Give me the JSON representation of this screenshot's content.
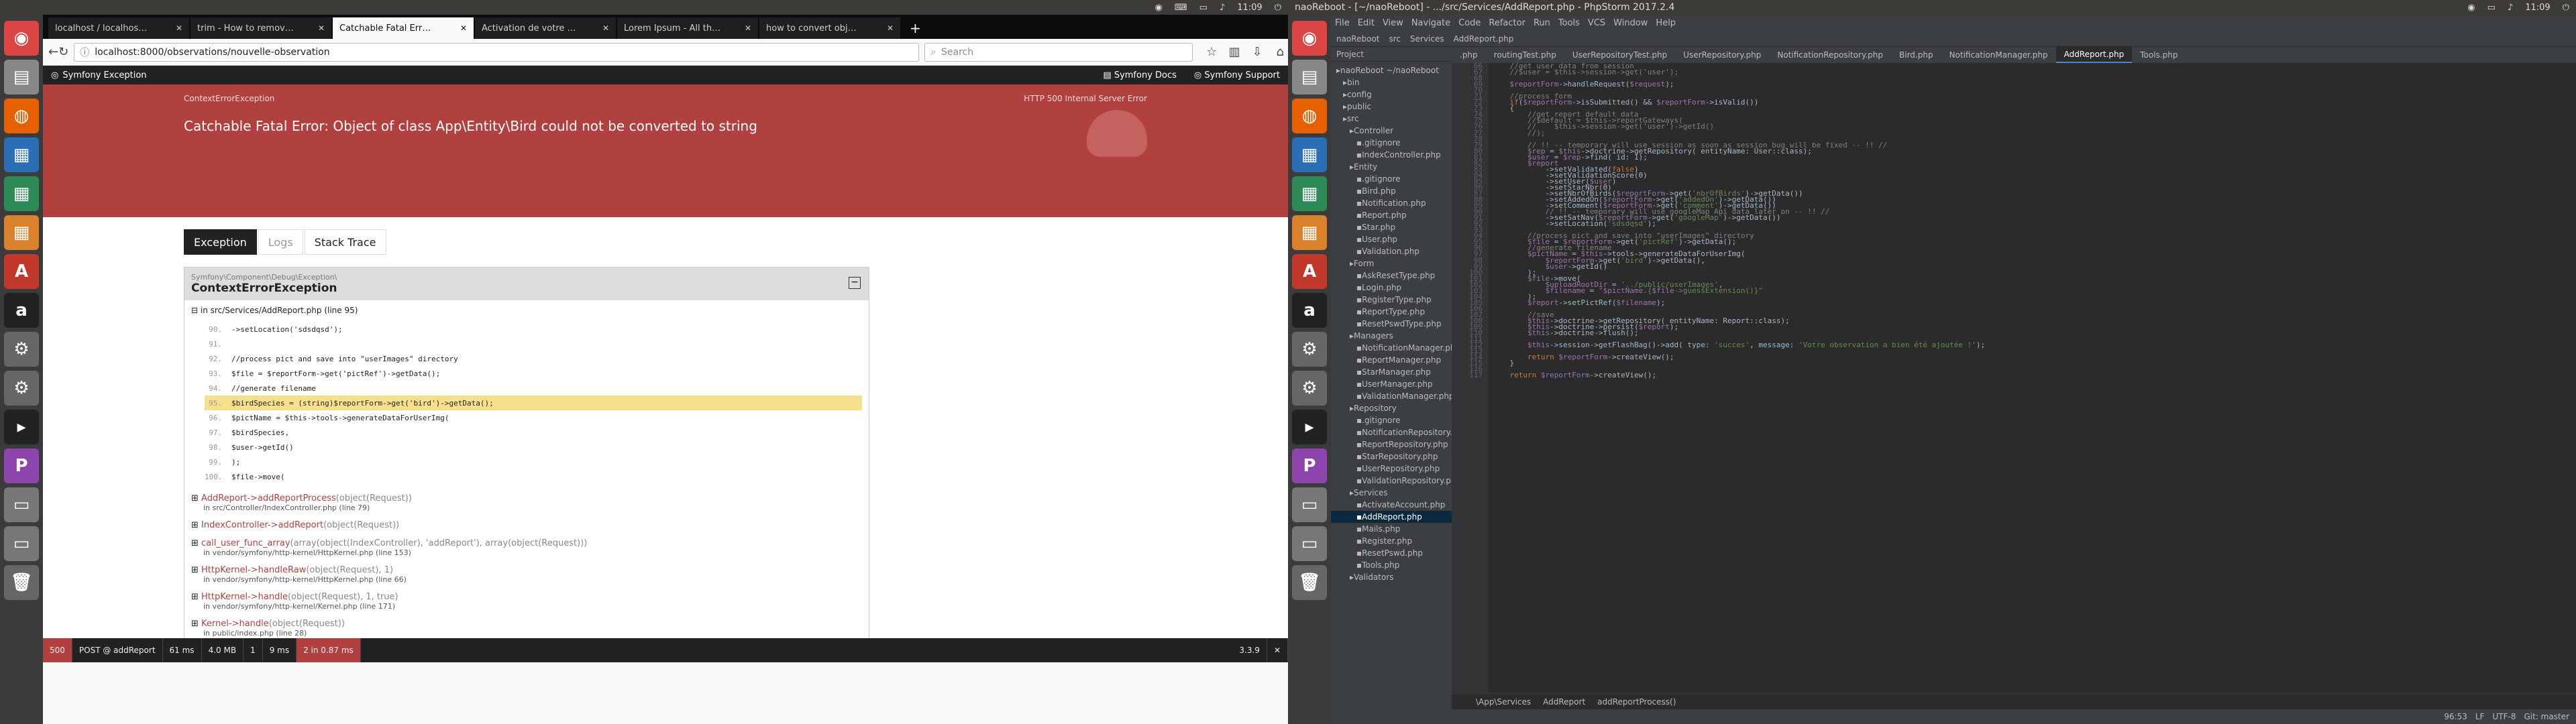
{
  "left": {
    "topbar": {
      "time": "11:09"
    },
    "launcher": [
      "chrome-icon",
      "files-icon",
      "firefox-icon",
      "writer-icon",
      "calc-icon",
      "impress-icon",
      "software-icon",
      "amazon-icon",
      "settings-icon",
      "settings2-icon",
      "terminal-icon",
      "phpstorm-icon",
      "drive-icon",
      "drive2-icon",
      "trash-icon"
    ],
    "browser": {
      "tabs": [
        {
          "label": "localhost / localhos…",
          "active": false
        },
        {
          "label": "trim - How to remov…",
          "active": false
        },
        {
          "label": "Catchable Fatal Err…",
          "active": true
        },
        {
          "label": "Activation de votre …",
          "active": false
        },
        {
          "label": "Lorem Ipsum - All th…",
          "active": false
        },
        {
          "label": "how to convert obj…",
          "active": false
        }
      ],
      "url": "localhost:8000/observations/nouvelle-observation",
      "search_placeholder": "Search",
      "symfony": {
        "brand": "Symfony Exception",
        "docs": "Symfony Docs",
        "support": "Symfony Support",
        "exception_type": "ContextErrorException",
        "http_status": "HTTP 500",
        "http_text": "Internal Server Error",
        "title": "Catchable Fatal Error: Object of class App\\Entity\\Bird could not be converted to string",
        "tabs": [
          "Exception",
          "Logs",
          "Stack Trace"
        ],
        "box_class": "Symfony\\Component\\Debug\\Exception\\",
        "box_name": "ContextErrorException",
        "location": "in src/Services/AddReport.php (line 95)",
        "code": [
          {
            "ln": "90.",
            "text": "->setLocation('sdsdqsd');",
            "hl": false
          },
          {
            "ln": "91.",
            "text": "",
            "hl": false
          },
          {
            "ln": "92.",
            "text": "//process pict and save into \"userImages\" directory",
            "hl": false
          },
          {
            "ln": "93.",
            "text": "$file = $reportForm->get('pictRef')->getData();",
            "hl": false
          },
          {
            "ln": "94.",
            "text": "//generate filename",
            "hl": false
          },
          {
            "ln": "95.",
            "text": "$birdSpecies = (string)$reportForm->get('bird')->getData();",
            "hl": true
          },
          {
            "ln": "96.",
            "text": "$pictName = $this->tools->generateDataForUserImg(",
            "hl": false
          },
          {
            "ln": "97.",
            "text": "  $birdSpecies,",
            "hl": false
          },
          {
            "ln": "98.",
            "text": "  $user->getId()",
            "hl": false
          },
          {
            "ln": "99.",
            "text": ");",
            "hl": false
          },
          {
            "ln": "100.",
            "text": "$file->move(",
            "hl": false
          }
        ],
        "trace": [
          {
            "fn": "AddReport->addReportProcess",
            "args": "(object(Request))",
            "loc": "in src/Controller/IndexController.php (line 79)"
          },
          {
            "fn": "IndexController->addReport",
            "args": "(object(Request))",
            "loc": ""
          },
          {
            "fn": "call_user_func_array",
            "args": "(array(object(IndexController), 'addReport'), array(object(Request)))",
            "loc": "in vendor/symfony/http-kernel/HttpKernel.php (line 153)"
          },
          {
            "fn": "HttpKernel->handleRaw",
            "args": "(object(Request), 1)",
            "loc": "in vendor/symfony/http-kernel/HttpKernel.php (line 66)"
          },
          {
            "fn": "HttpKernel->handle",
            "args": "(object(Request), 1, true)",
            "loc": "in vendor/symfony/http-kernel/Kernel.php (line 171)"
          },
          {
            "fn": "Kernel->handle",
            "args": "(object(Request))",
            "loc": "in public/index.php (line 28)"
          }
        ],
        "toolbar": {
          "status": "500",
          "method": "POST @ addReport",
          "time": "61 ms",
          "memory": "4.0 MB",
          "e1": "1",
          "e2": "9 ms",
          "err": "2 in 0.87 ms",
          "version": "3.3.9"
        }
      }
    }
  },
  "right": {
    "topbar": {
      "title": "naoReboot - [~/naoReboot] - .../src/Services/AddReport.php - PhpStorm 2017.2.4",
      "time": "11:09"
    },
    "menu": [
      "File",
      "Edit",
      "View",
      "Navigate",
      "Code",
      "Refactor",
      "Run",
      "Tools",
      "VCS",
      "Window",
      "Help"
    ],
    "breadcrumbs": [
      "naoReboot",
      "src",
      "Services",
      "AddReport.php"
    ],
    "project_label": "Project",
    "tree": [
      {
        "t": "naoReboot ~/naoReboot",
        "d": 0
      },
      {
        "t": "bin",
        "d": 1
      },
      {
        "t": "config",
        "d": 1
      },
      {
        "t": "public",
        "d": 1
      },
      {
        "t": "src",
        "d": 1
      },
      {
        "t": "Controller",
        "d": 2
      },
      {
        "t": ".gitignore",
        "d": 3
      },
      {
        "t": "IndexController.php",
        "d": 3
      },
      {
        "t": "Entity",
        "d": 2
      },
      {
        "t": ".gitignore",
        "d": 3
      },
      {
        "t": "Bird.php",
        "d": 3
      },
      {
        "t": "Notification.php",
        "d": 3
      },
      {
        "t": "Report.php",
        "d": 3
      },
      {
        "t": "Star.php",
        "d": 3
      },
      {
        "t": "User.php",
        "d": 3
      },
      {
        "t": "Validation.php",
        "d": 3
      },
      {
        "t": "Form",
        "d": 2
      },
      {
        "t": "AskResetType.php",
        "d": 3
      },
      {
        "t": "Login.php",
        "d": 3
      },
      {
        "t": "RegisterType.php",
        "d": 3
      },
      {
        "t": "ReportType.php",
        "d": 3
      },
      {
        "t": "ResetPswdType.php",
        "d": 3
      },
      {
        "t": "Managers",
        "d": 2
      },
      {
        "t": "NotificationManager.php",
        "d": 3
      },
      {
        "t": "ReportManager.php",
        "d": 3
      },
      {
        "t": "StarManager.php",
        "d": 3
      },
      {
        "t": "UserManager.php",
        "d": 3
      },
      {
        "t": "ValidationManager.php",
        "d": 3
      },
      {
        "t": "Repository",
        "d": 2
      },
      {
        "t": ".gitignore",
        "d": 3
      },
      {
        "t": "NotificationRepository.php",
        "d": 3
      },
      {
        "t": "ReportRepository.php",
        "d": 3
      },
      {
        "t": "StarRepository.php",
        "d": 3
      },
      {
        "t": "UserRepository.php",
        "d": 3
      },
      {
        "t": "ValidationRepository.php",
        "d": 3
      },
      {
        "t": "Services",
        "d": 2
      },
      {
        "t": "ActivateAccount.php",
        "d": 3
      },
      {
        "t": "AddReport.php",
        "d": 3,
        "sel": true
      },
      {
        "t": "Mails.php",
        "d": 3
      },
      {
        "t": "Register.php",
        "d": 3
      },
      {
        "t": "ResetPswd.php",
        "d": 3
      },
      {
        "t": "Tools.php",
        "d": 3
      },
      {
        "t": "Validators",
        "d": 2
      }
    ],
    "editor_tabs": [
      {
        "t": ".php",
        "a": false
      },
      {
        "t": "routingTest.php",
        "a": false
      },
      {
        "t": "UserRepositoryTest.php",
        "a": false
      },
      {
        "t": "UserRepository.php",
        "a": false
      },
      {
        "t": "NotificationRepository.php",
        "a": false
      },
      {
        "t": "Bird.php",
        "a": false
      },
      {
        "t": "NotificationManager.php",
        "a": false
      },
      {
        "t": "AddReport.php",
        "a": true
      },
      {
        "t": "Tools.php",
        "a": false
      }
    ],
    "first_line_no": 66,
    "code": [
      "    //get user data from session",
      "    //$user = $this->session->get('user');",
      "",
      "    $reportForm->handleRequest($request);",
      "",
      "    //process form",
      "    if($reportForm->isSubmitted() && $reportForm->isValid())",
      "    {",
      "        //get report default data",
      "        //$default = $this->reportGateways(",
      "        //    $this->session->get('user')->getId()",
      "        //);",
      "",
      "        // !! -- temporary will use session as soon as session bug will be fixed -- !! //",
      "        $rep = $this->doctrine->getRepository( entityName: User::class);",
      "        $user = $rep->find( id: 1);",
      "        $report",
      "            ->setValidated(false)",
      "            ->setValidationScore(0)",
      "            ->setUser($user)",
      "            ->setStarNbr(0)",
      "            ->setNbrOfBirds($reportForm->get('nbrOfBirds')->getData())",
      "            ->setAddedOn($reportForm->get('addedOn')->getData())",
      "            ->setComment($reportForm->get('comment')->getData())",
      "            // !! -- temporary will use googleMap Api data later on -- !! //",
      "            ->setSatNav($reportForm->get('googleMap')->getData())",
      "            ->setLocation('sdsdqsd');",
      "",
      "        //process pict and save into \"userImages\" directory",
      "        $file = $reportForm->get('pictRef')->getData();",
      "        //generate filename",
      "        $pictName = $this->tools->generateDataForUserImg(",
      "            $reportForm->get('bird')->getData(),",
      "            $user->getId()",
      "        );",
      "        $file->move(",
      "            $uploadRootDir = '../public/userImages',",
      "            $filename = \"$pictName.{$file->guessExtension()}\"",
      "        );",
      "        $report->setPictRef($filename);",
      "",
      "        //save",
      "        $this->doctrine->getRepository( entityName: Report::class);",
      "        $this->doctrine->persist($report);",
      "        $this->doctrine->flush();",
      "",
      "        $this->session->getFlashBag()->add( type: 'succes', message: 'Votre observation a bien été ajoutée !');",
      "",
      "        return $reportForm->createView();",
      "    }",
      "",
      "    return $reportForm->createView();"
    ],
    "editor_breadcrumb": [
      "\\App\\Services",
      "AddReport",
      "addReportProcess()"
    ],
    "status": [
      "96:53",
      "LF",
      "UTF-8",
      "Git: master"
    ]
  }
}
